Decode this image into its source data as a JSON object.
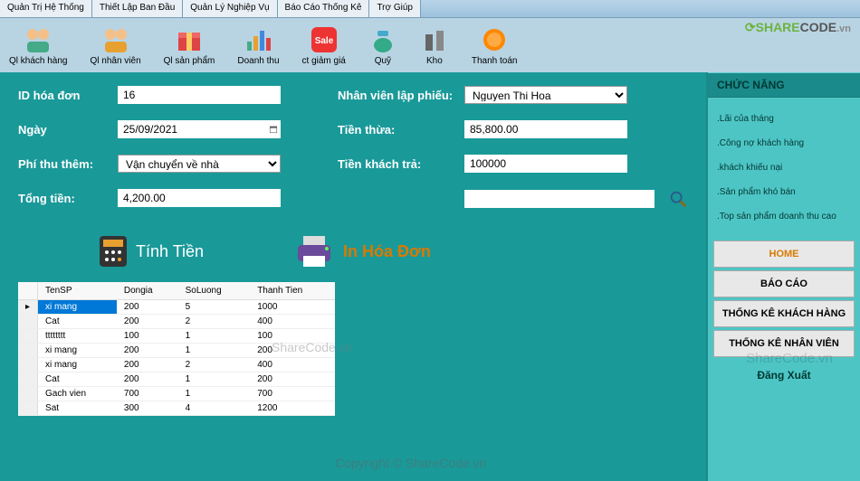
{
  "menubar": [
    "Quản Trị Hệ Thống",
    "Thiết Lập Ban Đầu",
    "Quản Lý Nghiệp Vụ",
    "Báo Cáo Thống Kê",
    "Trợ Giúp"
  ],
  "toolbar": [
    {
      "label": "Ql khách hàng",
      "icon": "users"
    },
    {
      "label": "Ql nhân viên",
      "icon": "users2"
    },
    {
      "label": "Ql sản phẩm",
      "icon": "box"
    },
    {
      "label": "Doanh thu",
      "icon": "chart"
    },
    {
      "label": "ct giảm giá",
      "icon": "sale"
    },
    {
      "label": "Quỹ",
      "icon": "fund"
    },
    {
      "label": "Kho",
      "icon": "warehouse"
    },
    {
      "label": "Thanh toán",
      "icon": "payment"
    }
  ],
  "logo": {
    "share": "SHARE",
    "code": "CODE",
    "vn": ".vn"
  },
  "form": {
    "id_label": "ID hóa đơn",
    "id_value": "16",
    "date_label": "Ngày",
    "date_value": "25/09/2021",
    "fee_label": "Phí thu thêm:",
    "fee_value": "Vận chuyển về nhà",
    "total_label": "Tổng tiền:",
    "total_value": "4,200.00",
    "employee_label": "Nhân viên lập phiếu:",
    "employee_value": "Nguyen Thi Hoa",
    "change_label": "Tiền thừa:",
    "change_value": "85,800.00",
    "paid_label": "Tiền khách trả:",
    "paid_value": "100000",
    "search_value": ""
  },
  "actions": {
    "calc": "Tính Tiền",
    "print": "In Hóa Đơn"
  },
  "table": {
    "headers": [
      "TenSP",
      "Dongia",
      "SoLuong",
      "Thanh Tien"
    ],
    "rows": [
      [
        "xi mang",
        "200",
        "5",
        "1000"
      ],
      [
        "Cat",
        "200",
        "2",
        "400"
      ],
      [
        "tttttttt",
        "100",
        "1",
        "100"
      ],
      [
        "xi mang",
        "200",
        "1",
        "200"
      ],
      [
        "xi mang",
        "200",
        "2",
        "400"
      ],
      [
        "Cat",
        "200",
        "1",
        "200"
      ],
      [
        "Gach vien",
        "700",
        "1",
        "700"
      ],
      [
        "Sat",
        "300",
        "4",
        "1200"
      ]
    ]
  },
  "sidebar": {
    "header": "CHỨC NĂNG",
    "items": [
      ".Lãi của tháng",
      ".Công nợ khách hàng",
      ".khách khiếu nại",
      ".Sản phẩm khó bán",
      ".Top sản phẩm doanh thu cao"
    ],
    "buttons": [
      "HOME",
      "BÁO CÁO",
      "THỐNG KÊ KHÁCH HÀNG",
      "THỐNG KÊ NHÂN VIÊN"
    ],
    "logout": "Đăng Xuất"
  },
  "watermark": "ShareCode.vn",
  "copyright": "Copyright © ShareCode.vn"
}
